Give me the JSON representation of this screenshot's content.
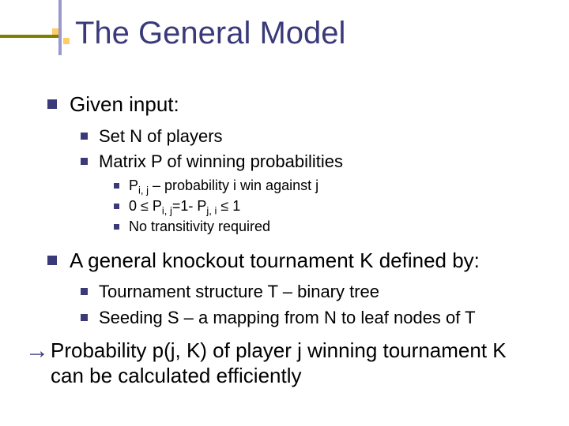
{
  "title": "The General Model",
  "l1a": "Given input:",
  "l2a": "Set N of players",
  "l2b": "Matrix P of winning probabilities",
  "l3a_pre": "P",
  "l3a_sub": "i, j",
  "l3a_post": " – probability i win against j",
  "l3b_pre": "0 ",
  "l3b_le1": "≤",
  "l3b_mid1": " P",
  "l3b_sub1": "i, j",
  "l3b_mid2": "=1- P",
  "l3b_sub2": "j, i",
  "l3b_le2": " ≤",
  "l3b_post": " 1",
  "l3c": "No transitivity required",
  "l1b": "A general knockout tournament K defined by:",
  "l2c": "Tournament structure T – binary tree",
  "l2d": "Seeding S – a mapping from N to leaf nodes of T",
  "concl": " Probability p(j, K) of player j winning tournament K can be  calculated efficiently",
  "arrow_glyph": "→"
}
